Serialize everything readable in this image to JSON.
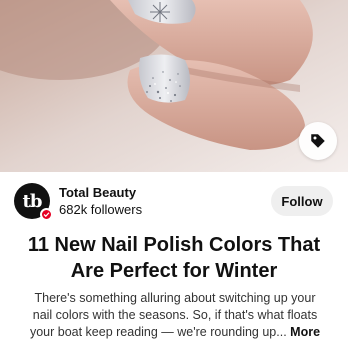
{
  "pin": {
    "image_alt": "Pale pink nails with glitter and snowflake nail art",
    "tag_icon": "tag-icon"
  },
  "profile": {
    "name": "Total Beauty",
    "followers": "682k followers",
    "avatar_text": "tb",
    "verified_icon": "check-icon"
  },
  "follow_label": "Follow",
  "article": {
    "title": "11 New Nail Polish Colors That Are Perfect for Winter",
    "description_lines": [
      "There's something alluring about switching up your",
      "nail colors with the seasons. So, if that's what floats",
      "your boat keep reading — we're rounding up..."
    ],
    "more_label": "More"
  },
  "colors": {
    "verified_badge": "#e60023",
    "follow_button_bg": "#efefef",
    "nail_polish": "#dcdde2",
    "skin": "#d8aea0"
  }
}
